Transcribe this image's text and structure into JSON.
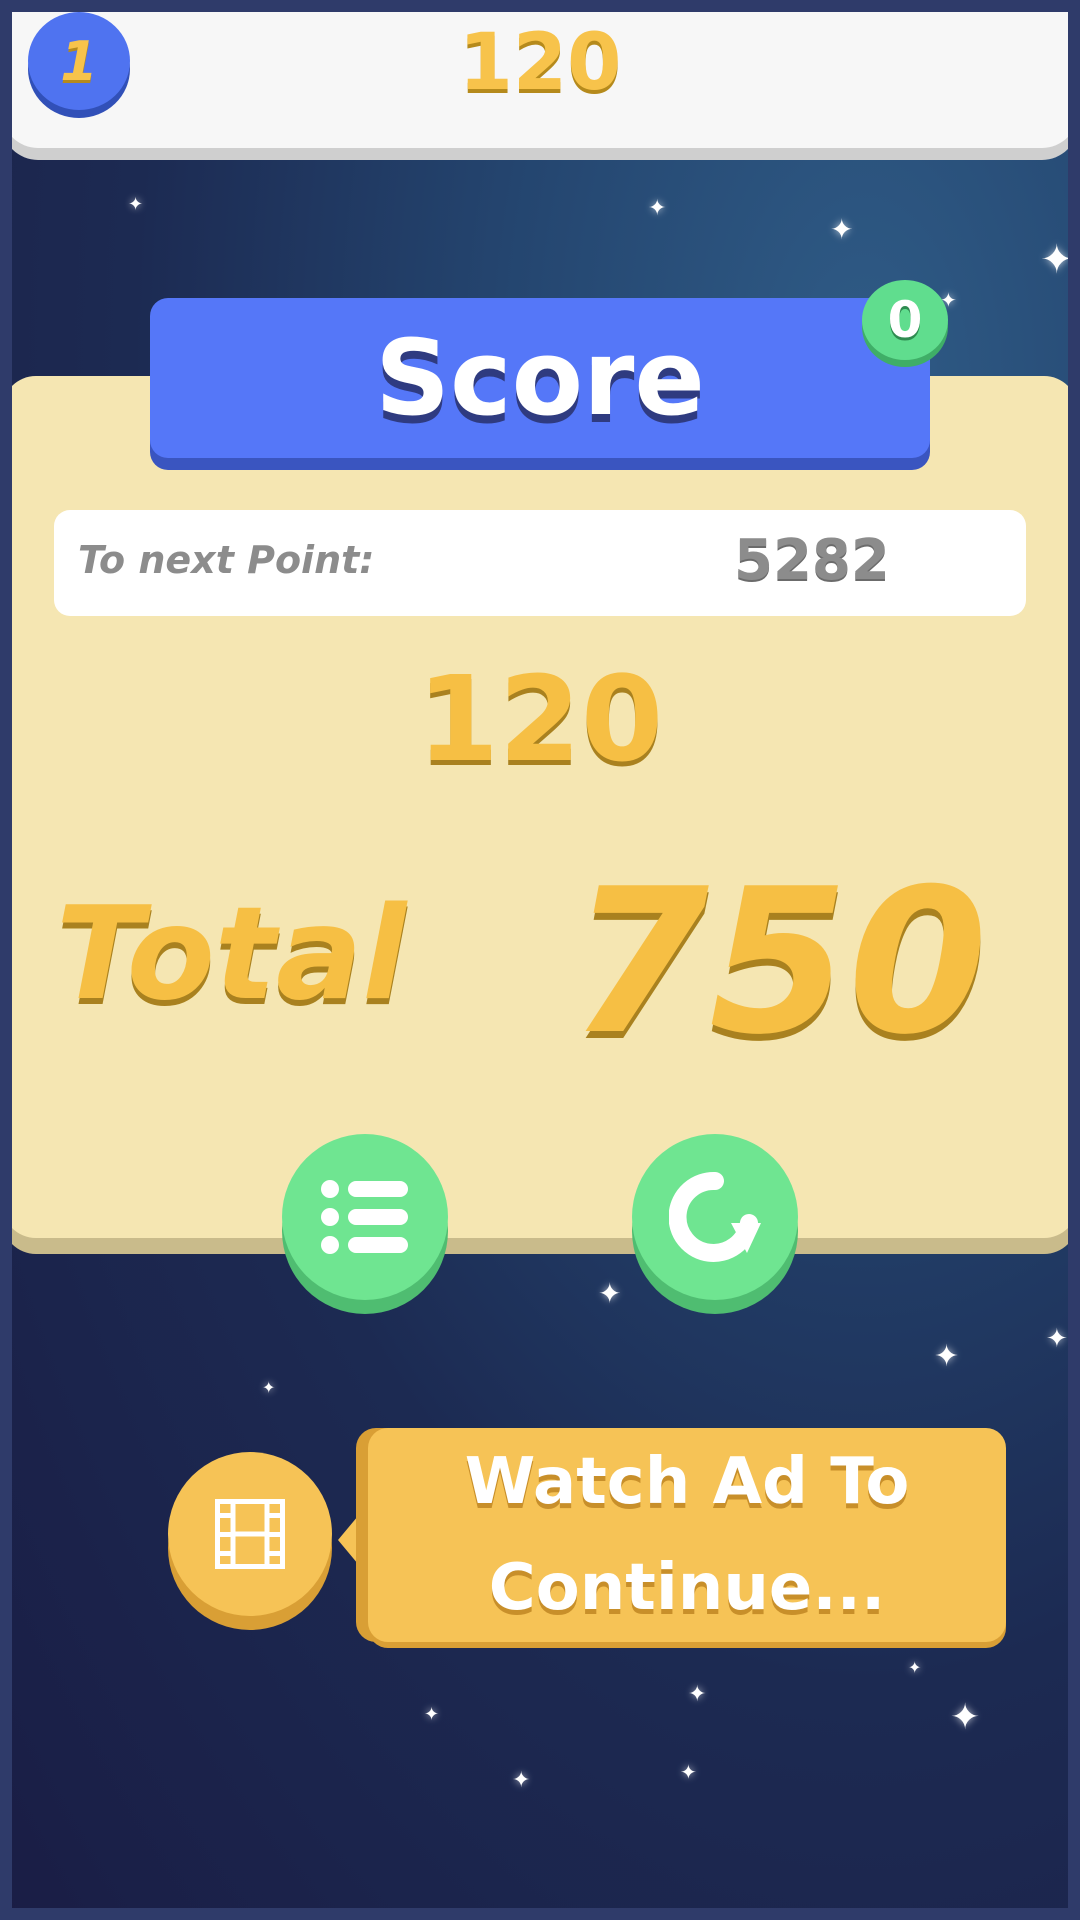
{
  "top_bar": {
    "level": "1",
    "score": "120"
  },
  "score_panel": {
    "title": "Score",
    "badge_count": "0",
    "next_point_label": "To next Point:",
    "next_point_value": "5282",
    "round_score": "120",
    "total_label": "Total",
    "total_value": "750"
  },
  "buttons": {
    "menu_icon": "list-icon",
    "replay_icon": "replay-icon"
  },
  "ad": {
    "icon": "film-icon",
    "label_line1": "Watch Ad To",
    "label_line2": "Continue..."
  },
  "colors": {
    "gold": "#f6bf44",
    "blue": "#5577f8",
    "green": "#6fe591",
    "panel": "#f5e6b2",
    "ad_yellow": "#f6c356"
  }
}
